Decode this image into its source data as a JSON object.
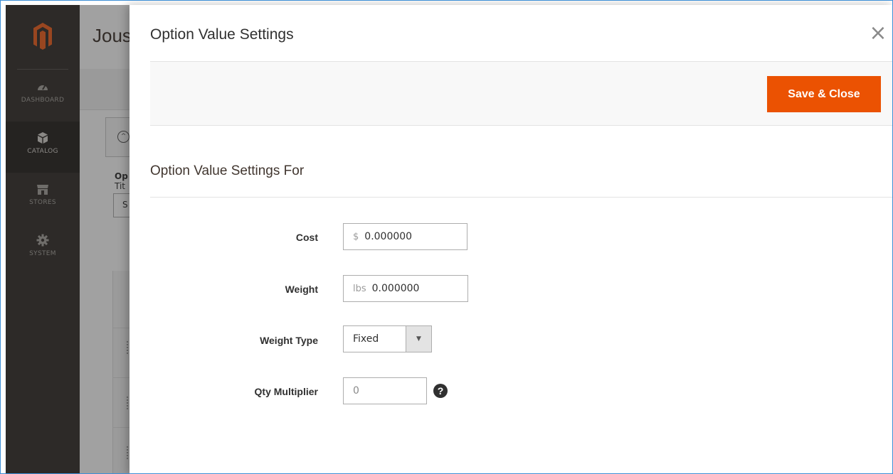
{
  "sidebar": {
    "items": [
      {
        "label": "DASHBOARD",
        "icon": "dashboard-icon"
      },
      {
        "label": "CATALOG",
        "icon": "box-icon"
      },
      {
        "label": "STORES",
        "icon": "store-icon"
      },
      {
        "label": "SYSTEM",
        "icon": "gear-icon"
      }
    ],
    "active": "CATALOG"
  },
  "background_page": {
    "title": "Jous",
    "section_label": "Op",
    "title_label": "Tit",
    "input_value": "S"
  },
  "modal": {
    "title": "Option Value Settings",
    "close_icon": "×",
    "save_button": "Save & Close",
    "section_title": "Option Value Settings For",
    "fields": {
      "cost": {
        "label": "Cost",
        "addon": "$",
        "value": "0.000000"
      },
      "weight": {
        "label": "Weight",
        "addon": "lbs",
        "value": "0.000000"
      },
      "weight_type": {
        "label": "Weight Type",
        "value": "Fixed"
      },
      "qty_multiplier": {
        "label": "Qty Multiplier",
        "value": "0"
      }
    },
    "help_icon": "?"
  },
  "colors": {
    "sidebar_bg": "#373330",
    "accent": "#eb5202",
    "logo": "#f26322",
    "frame_border": "#3d8fd6"
  }
}
